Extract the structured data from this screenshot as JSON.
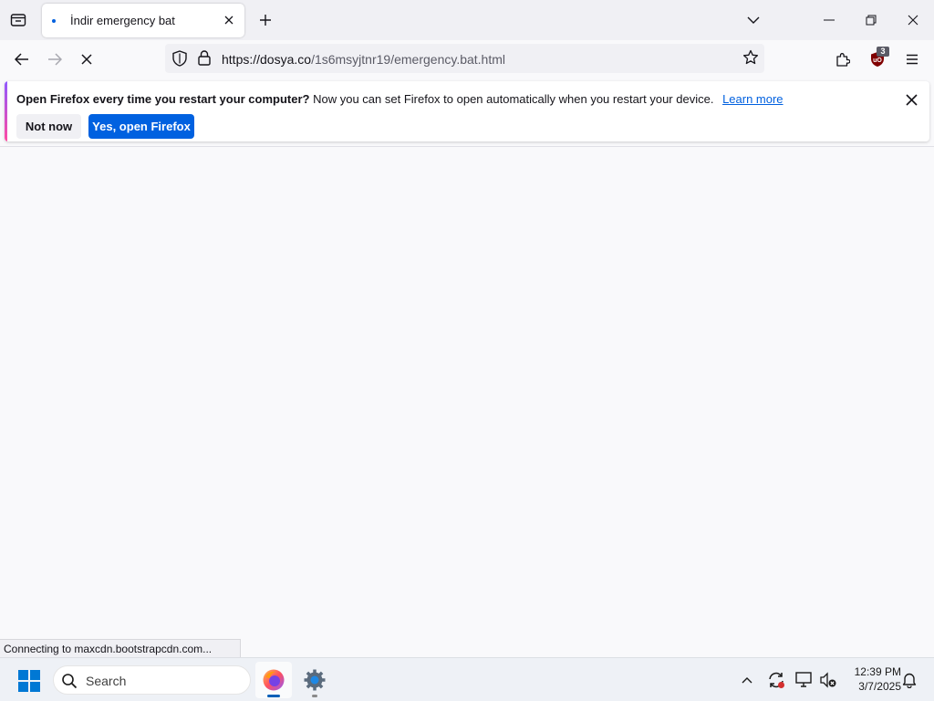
{
  "browser": {
    "tab": {
      "title": "İndir emergency bat"
    },
    "url": {
      "host": "https://dosya.co",
      "path": "/1s6msyjtnr19/emergency.bat.html"
    },
    "extension_badge": "3"
  },
  "notification": {
    "bold_text": "Open Firefox every time you restart your computer?",
    "text": "Now you can set Firefox to open automatically when you restart your device.",
    "link": "Learn more",
    "secondary_button": "Not now",
    "primary_button": "Yes, open Firefox"
  },
  "status_text": "Connecting to maxcdn.bootstrapcdn.com...",
  "taskbar": {
    "search_placeholder": "Search",
    "time": "12:39 PM",
    "date": "3/7/2025"
  },
  "colors": {
    "accent": "#0061e0",
    "tab_strip": "#f0f0f4",
    "content_bg": "#f9f9fb"
  }
}
